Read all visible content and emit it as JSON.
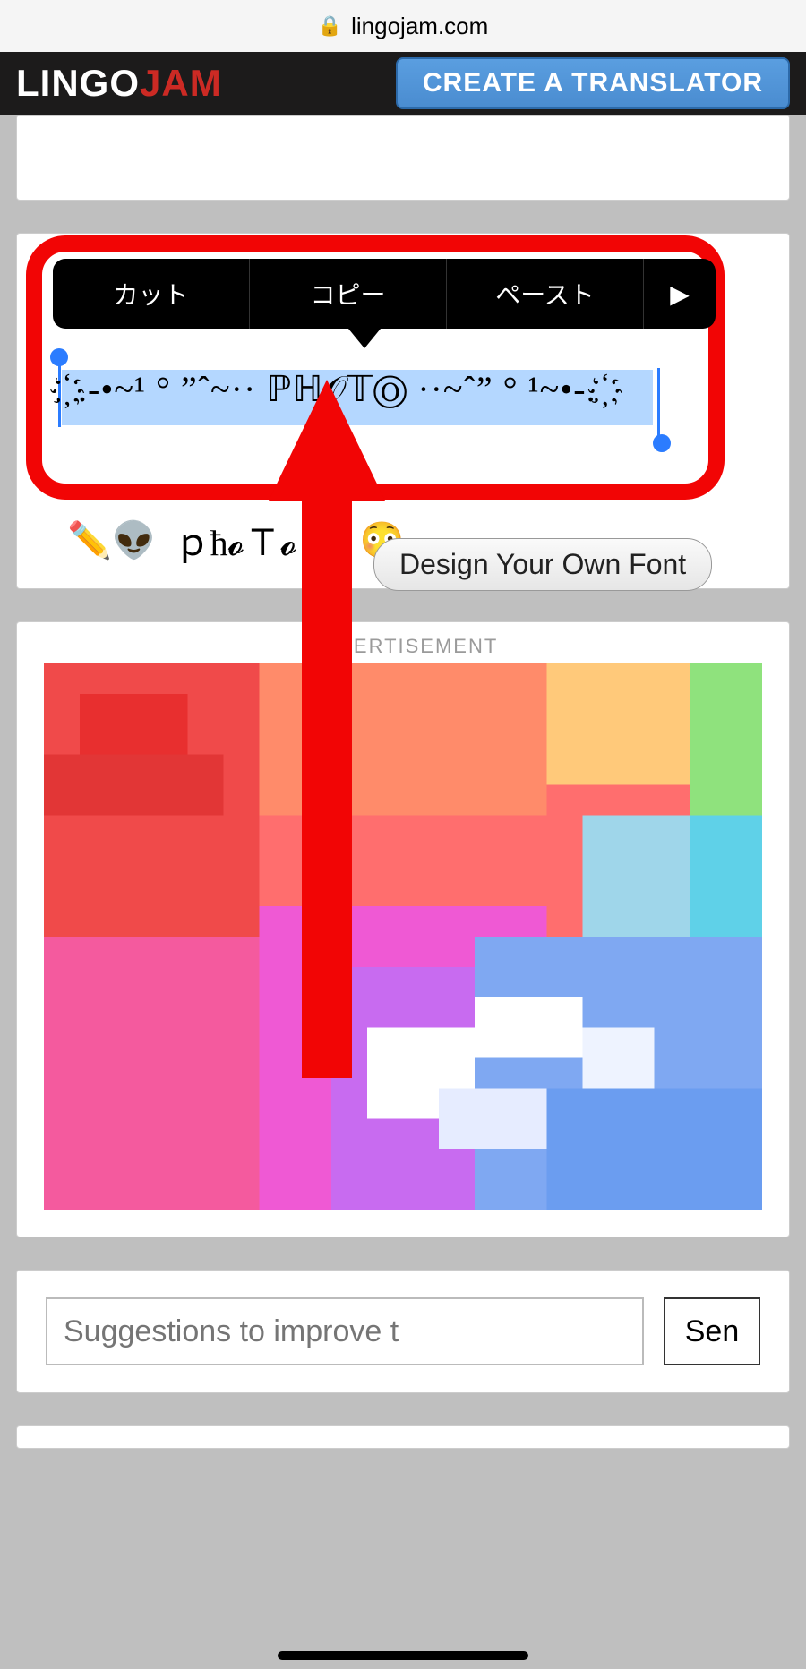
{
  "address_bar": {
    "domain": "lingojam.com"
  },
  "nav": {
    "logo_lingo": "LINGO",
    "logo_jam": "JAM",
    "create_translator": "CREATE A TRANSLATOR"
  },
  "context_menu": {
    "cut": "カット",
    "copy": "コピー",
    "paste": "ペースト",
    "more": "▶"
  },
  "generated": {
    "selected_text": "҉ .-•~¹ ° ”ˆ~·· ℙℍ𝒪𝕋Ⓞ ··~ˆ” ° ¹~•-. ҉",
    "line2_prefix": "✏️👽",
    "line2_text": "ｐħ𝓸Ｔ𝓸",
    "line2_suffix": "♟️😳"
  },
  "design_button": "Design Your Own Font",
  "ad": {
    "label": "ADVERTISEMENT"
  },
  "suggest": {
    "placeholder": "Suggestions to improve t",
    "send": "Sen"
  }
}
